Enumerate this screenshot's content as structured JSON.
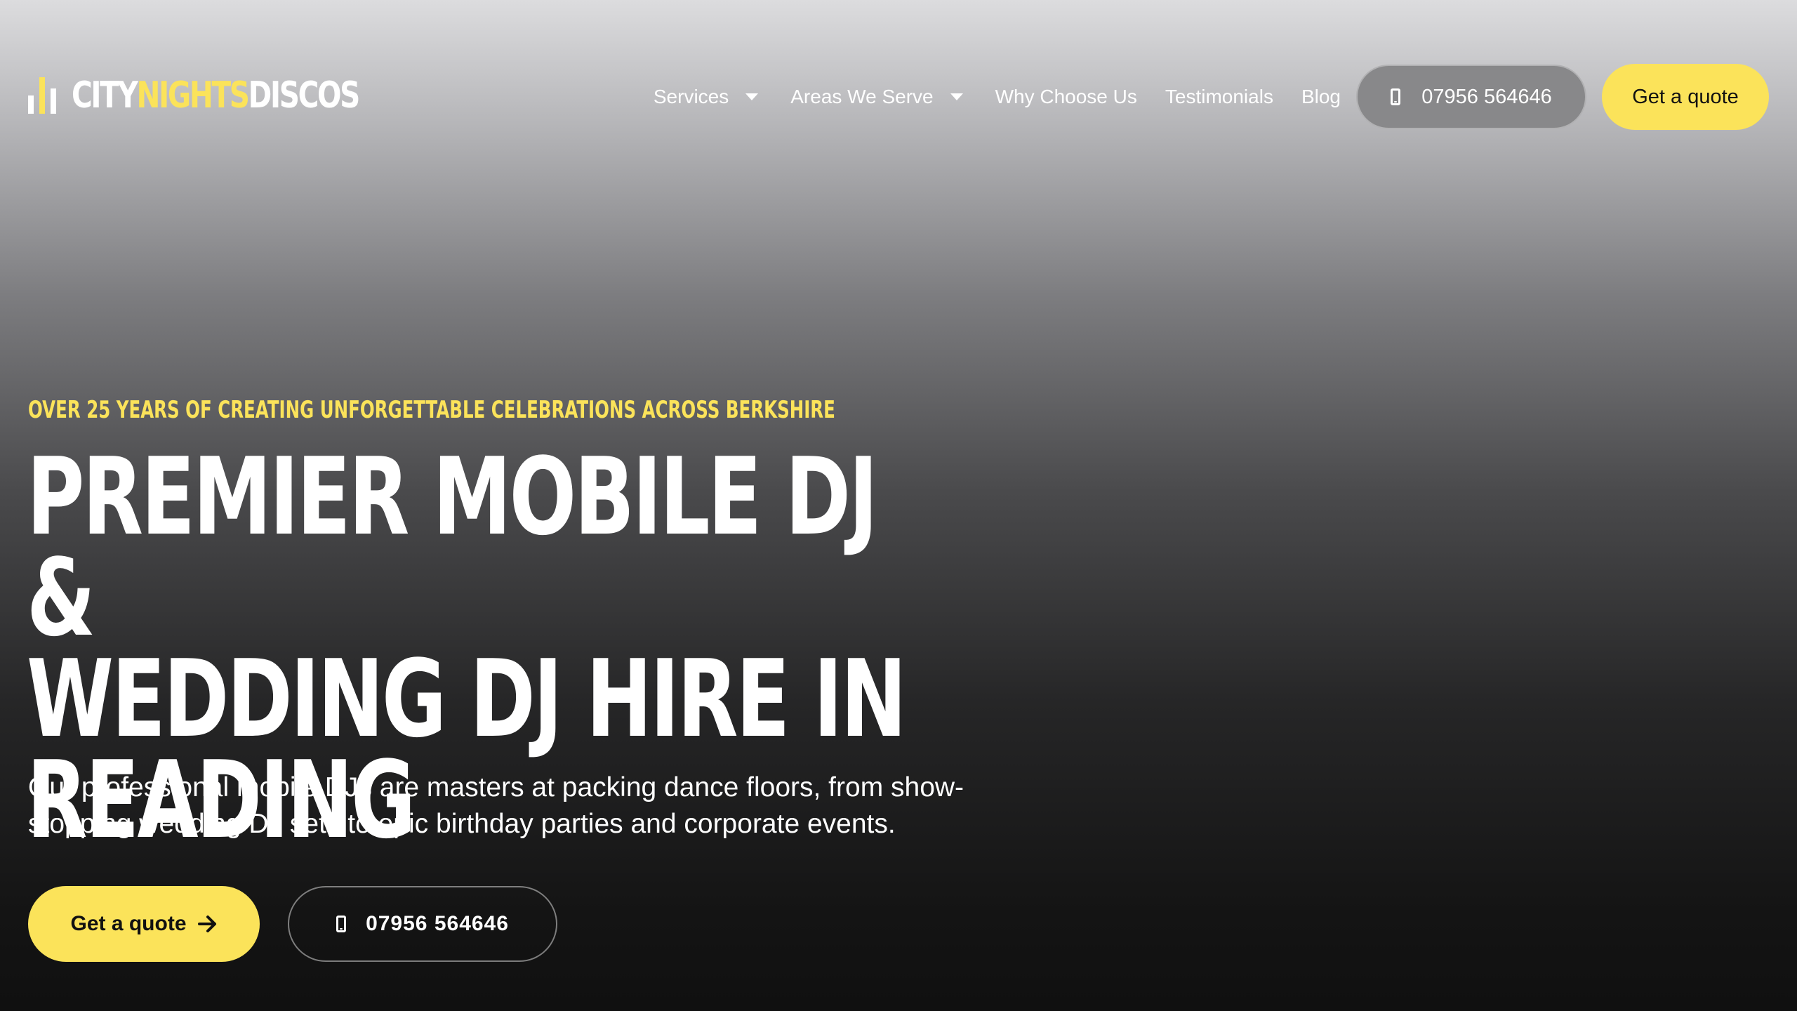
{
  "brand": {
    "logo_part1": "CITY",
    "logo_part2": "NIGHTS",
    "logo_part3": "DISCOS",
    "icon": "equalizer-bars-icon"
  },
  "nav": {
    "items": [
      {
        "label": "Services",
        "has_dropdown": true
      },
      {
        "label": "Areas We Serve",
        "has_dropdown": true
      },
      {
        "label": "Why Choose Us",
        "has_dropdown": false
      },
      {
        "label": "Testimonials",
        "has_dropdown": false
      },
      {
        "label": "Blog",
        "has_dropdown": false
      }
    ],
    "phone": "07956 564646",
    "cta": "Get a quote"
  },
  "hero": {
    "eyebrow": "OVER 25 YEARS OF CREATING UNFORGETTABLE CELEBRATIONS ACROSS BERKSHIRE",
    "headline_line1": "PREMIER MOBILE DJ &",
    "headline_line2": "WEDDING DJ HIRE IN",
    "headline_line3": "READING",
    "subtext": "Our professional mobile DJs are masters at packing dance floors, from show-stopping wedding DJ sets to epic birthday parties and corporate events.",
    "cta_quote": "Get a quote",
    "cta_phone": "07956 564646"
  },
  "colors": {
    "accent": "#fbe35a",
    "text": "#ffffff",
    "background_bottom": "#101010"
  }
}
